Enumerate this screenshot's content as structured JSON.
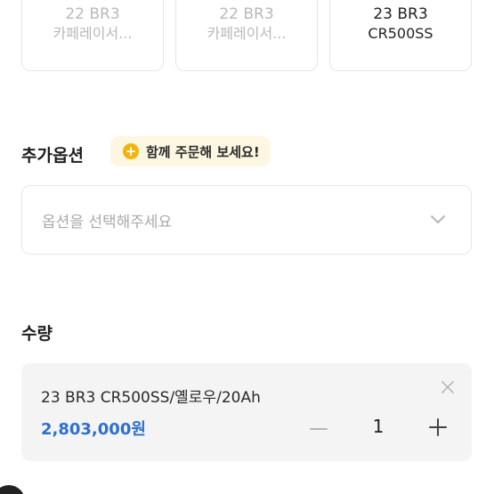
{
  "variant_cards": [
    {
      "line1": "22 BR3",
      "line2": "카페레이서..."
    },
    {
      "line1": "22 BR3",
      "line2": "카페레이서..."
    },
    {
      "line1": "23 BR3",
      "line2": "CR500SS"
    }
  ],
  "additional_options": {
    "title": "추가옵션",
    "promo_text": "함께 주문해 보세요!",
    "select_placeholder": "옵션을 선택해주세요"
  },
  "quantity": {
    "title": "수량",
    "item_name": "23 BR3 CR500SS/옐로우/20Ah",
    "price": "2,803,000원",
    "count": "1"
  },
  "colors": {
    "price_blue": "#2d6fd0",
    "promo_bg": "#fdf6e1",
    "promo_icon": "#f2b40c"
  }
}
